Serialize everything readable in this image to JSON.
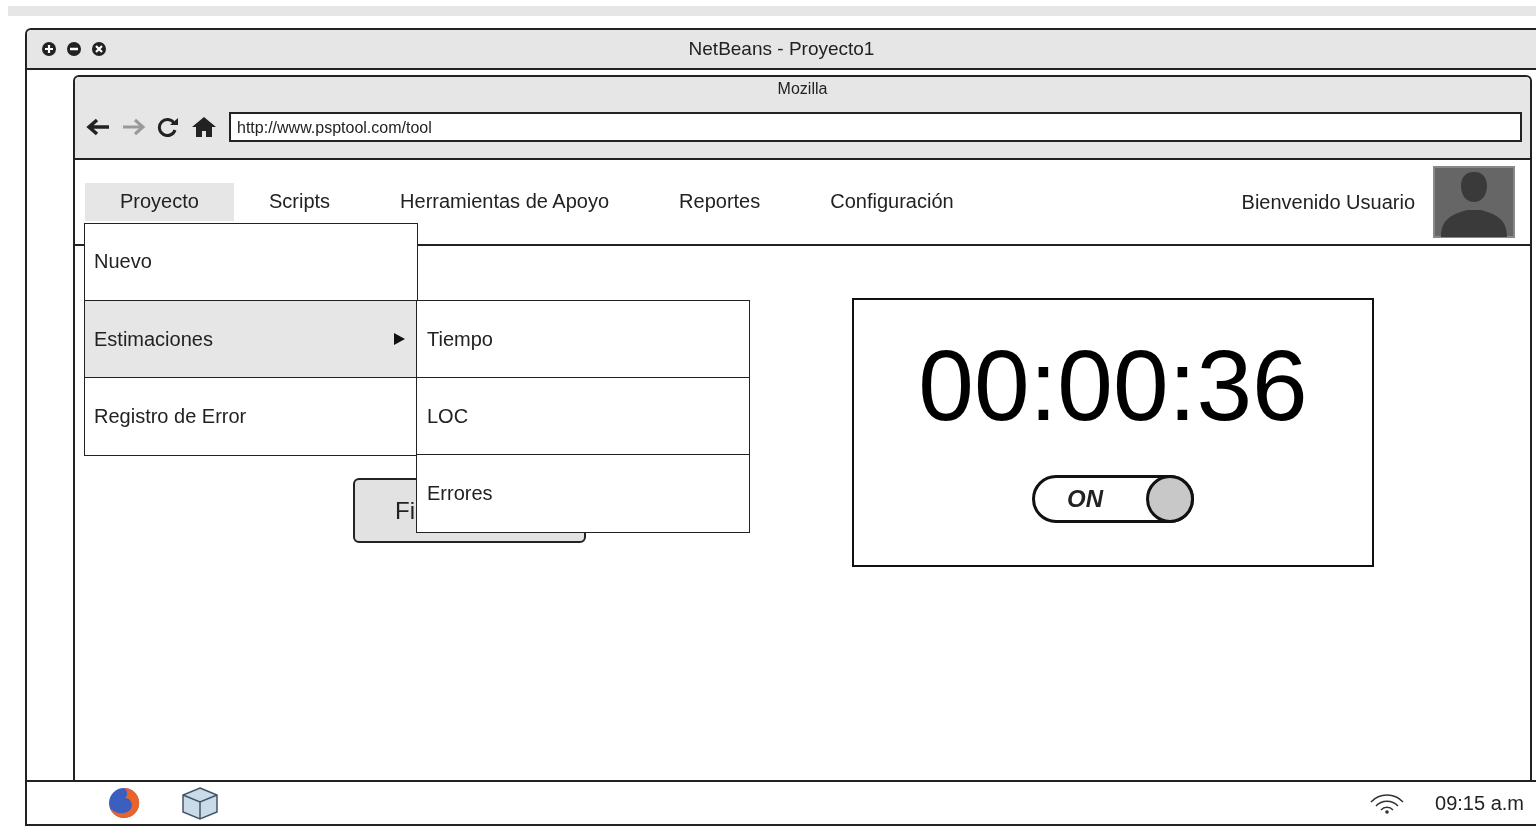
{
  "window": {
    "title": "NetBeans - Proyecto1"
  },
  "browser": {
    "title": "Mozilla",
    "url": "http://www.psptool.com/tool"
  },
  "nav": {
    "items": [
      {
        "label": "Proyecto",
        "selected": true
      },
      {
        "label": "Scripts",
        "selected": false
      },
      {
        "label": "Herramientas de Apoyo",
        "selected": false
      },
      {
        "label": "Reportes",
        "selected": false
      },
      {
        "label": "Configuración",
        "selected": false
      }
    ],
    "welcome": "Bienvenido Usuario"
  },
  "menu": {
    "items": [
      {
        "label": "Nuevo",
        "selected": false,
        "has_submenu": false
      },
      {
        "label": "Estimaciones",
        "selected": true,
        "has_submenu": true
      },
      {
        "label": "Registro de Error",
        "selected": false,
        "has_submenu": false
      }
    ],
    "submenu": [
      {
        "label": "Tiempo"
      },
      {
        "label": "LOC"
      },
      {
        "label": "Errores"
      }
    ]
  },
  "content": {
    "button": "Fi"
  },
  "timer": {
    "time": "00:00:36",
    "toggle": {
      "label": "ON",
      "on": true
    }
  },
  "taskbar": {
    "clock": "09:15 a.m"
  }
}
